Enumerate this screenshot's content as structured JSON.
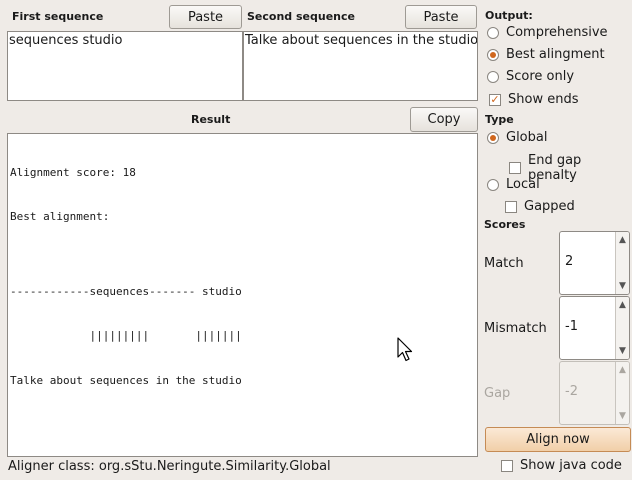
{
  "first": {
    "label": "First sequence",
    "paste_label": "Paste",
    "value": "sequences studio"
  },
  "second": {
    "label": "Second sequence",
    "paste_label": "Paste",
    "value": "Talke about sequences in the studio"
  },
  "result": {
    "label": "Result",
    "copy_label": "Copy",
    "lines": [
      "Alignment score: 18",
      "Best alignment:",
      "",
      "------------sequences------- studio",
      "            |||||||||       |||||||",
      "Talke about sequences in the studio"
    ]
  },
  "output": {
    "label": "Output:",
    "options": [
      {
        "label": "Comprehensive",
        "selected": false
      },
      {
        "label": "Best alingment",
        "selected": true
      },
      {
        "label": "Score only",
        "selected": false
      }
    ],
    "show_ends": {
      "label": "Show ends",
      "checked": true
    }
  },
  "type": {
    "label": "Type",
    "global": {
      "label": "Global",
      "selected": true
    },
    "end_gap_penalty": {
      "label": "End gap penalty",
      "checked": false
    },
    "local": {
      "label": "Local",
      "selected": false
    },
    "gapped": {
      "label": "Gapped",
      "checked": false
    }
  },
  "scores": {
    "label": "Scores",
    "match": {
      "label": "Match",
      "value": "2"
    },
    "mismatch": {
      "label": "Mismatch",
      "value": "-1"
    },
    "gap": {
      "label": "Gap",
      "value": "-2",
      "enabled": false
    }
  },
  "align_now_label": "Align now",
  "show_java_code": {
    "label": "Show java code",
    "checked": false
  },
  "status": "Aligner class: org.sStu.Neringute.Similarity.Global",
  "colors": {
    "accent": "#d0671e",
    "background": "#efebe7"
  }
}
